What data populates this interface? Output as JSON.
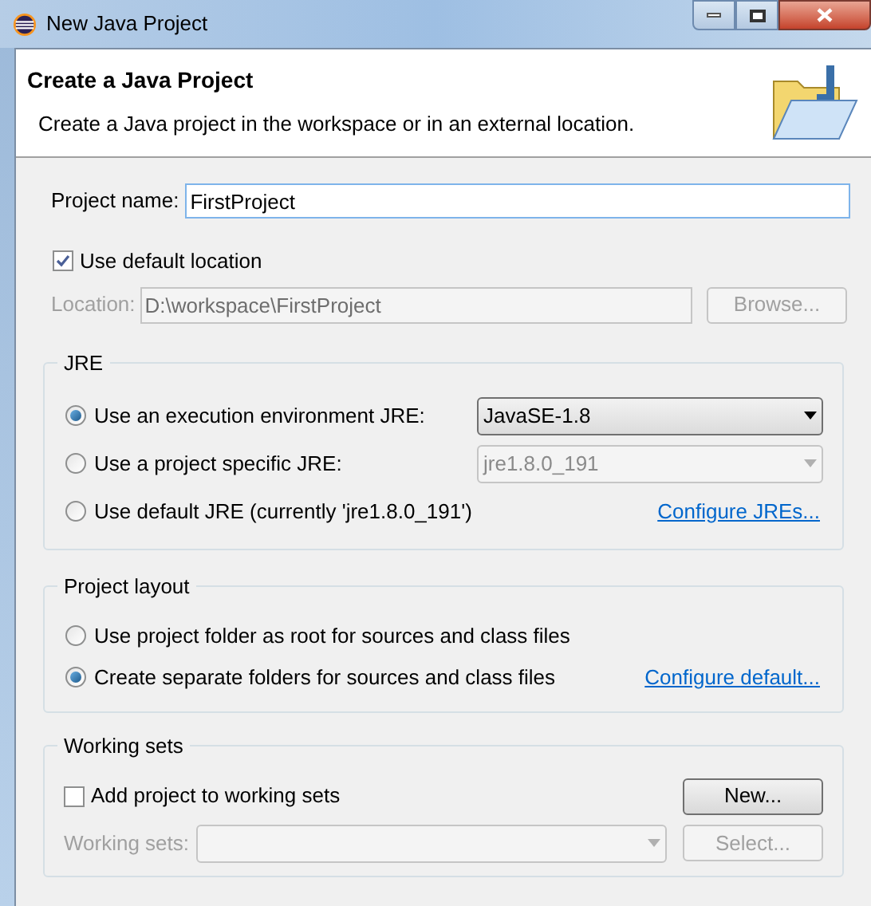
{
  "window": {
    "title": "New Java Project"
  },
  "header": {
    "title": "Create a Java Project",
    "description": "Create a Java project in the workspace or in an external location."
  },
  "project_name": {
    "label": "Project name:",
    "value": "FirstProject"
  },
  "use_default_location": {
    "label": "Use default location",
    "checked": true
  },
  "location": {
    "label": "Location:",
    "value": "D:\\workspace\\FirstProject",
    "disabled": true,
    "button": "Browse..."
  },
  "jre": {
    "title": "JRE",
    "options": [
      {
        "label": "Use an execution environment JRE:",
        "selected": true,
        "kind": "combo",
        "value": "JavaSE-1.8",
        "disabled": false
      },
      {
        "label": "Use a project specific JRE:",
        "selected": false,
        "kind": "combo",
        "value": "jre1.8.0_191",
        "disabled": true
      },
      {
        "label": "Use default JRE (currently 'jre1.8.0_191')",
        "selected": false,
        "kind": "link",
        "link": "Configure JREs..."
      }
    ]
  },
  "project_layout": {
    "title": "Project layout",
    "options": [
      {
        "label": "Use project folder as root for sources and class files",
        "selected": false
      },
      {
        "label": "Create separate folders for sources and class files",
        "selected": true,
        "link": "Configure default..."
      }
    ]
  },
  "working_sets": {
    "title": "Working sets",
    "add": {
      "label": "Add project to working sets",
      "checked": false,
      "button": "New..."
    },
    "sets": {
      "label": "Working sets:",
      "disabled": true,
      "button": "Select..."
    }
  }
}
